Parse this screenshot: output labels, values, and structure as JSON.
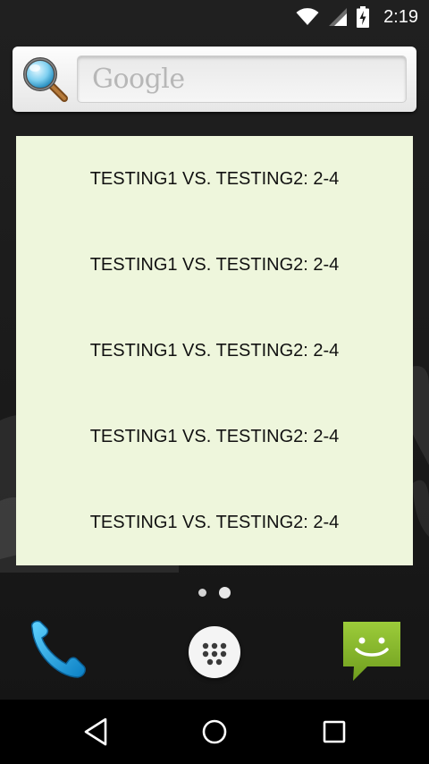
{
  "status_bar": {
    "time": "2:19"
  },
  "search": {
    "placeholder": "Google"
  },
  "widget": {
    "rows": [
      "TESTING1 VS. TESTING2: 2-4",
      "TESTING1 VS. TESTING2: 2-4",
      "TESTING1 VS. TESTING2: 2-4",
      "TESTING1 VS. TESTING2: 2-4",
      "TESTING1 VS. TESTING2: 2-4"
    ],
    "background_color": "#eef6dc"
  },
  "page_indicator": {
    "pages": 2,
    "current": 2
  },
  "dock": {
    "items": [
      "phone-icon",
      "app-drawer-icon",
      "messaging-icon"
    ]
  },
  "navigation": {
    "buttons": [
      "back-icon",
      "home-icon",
      "recents-icon"
    ]
  }
}
